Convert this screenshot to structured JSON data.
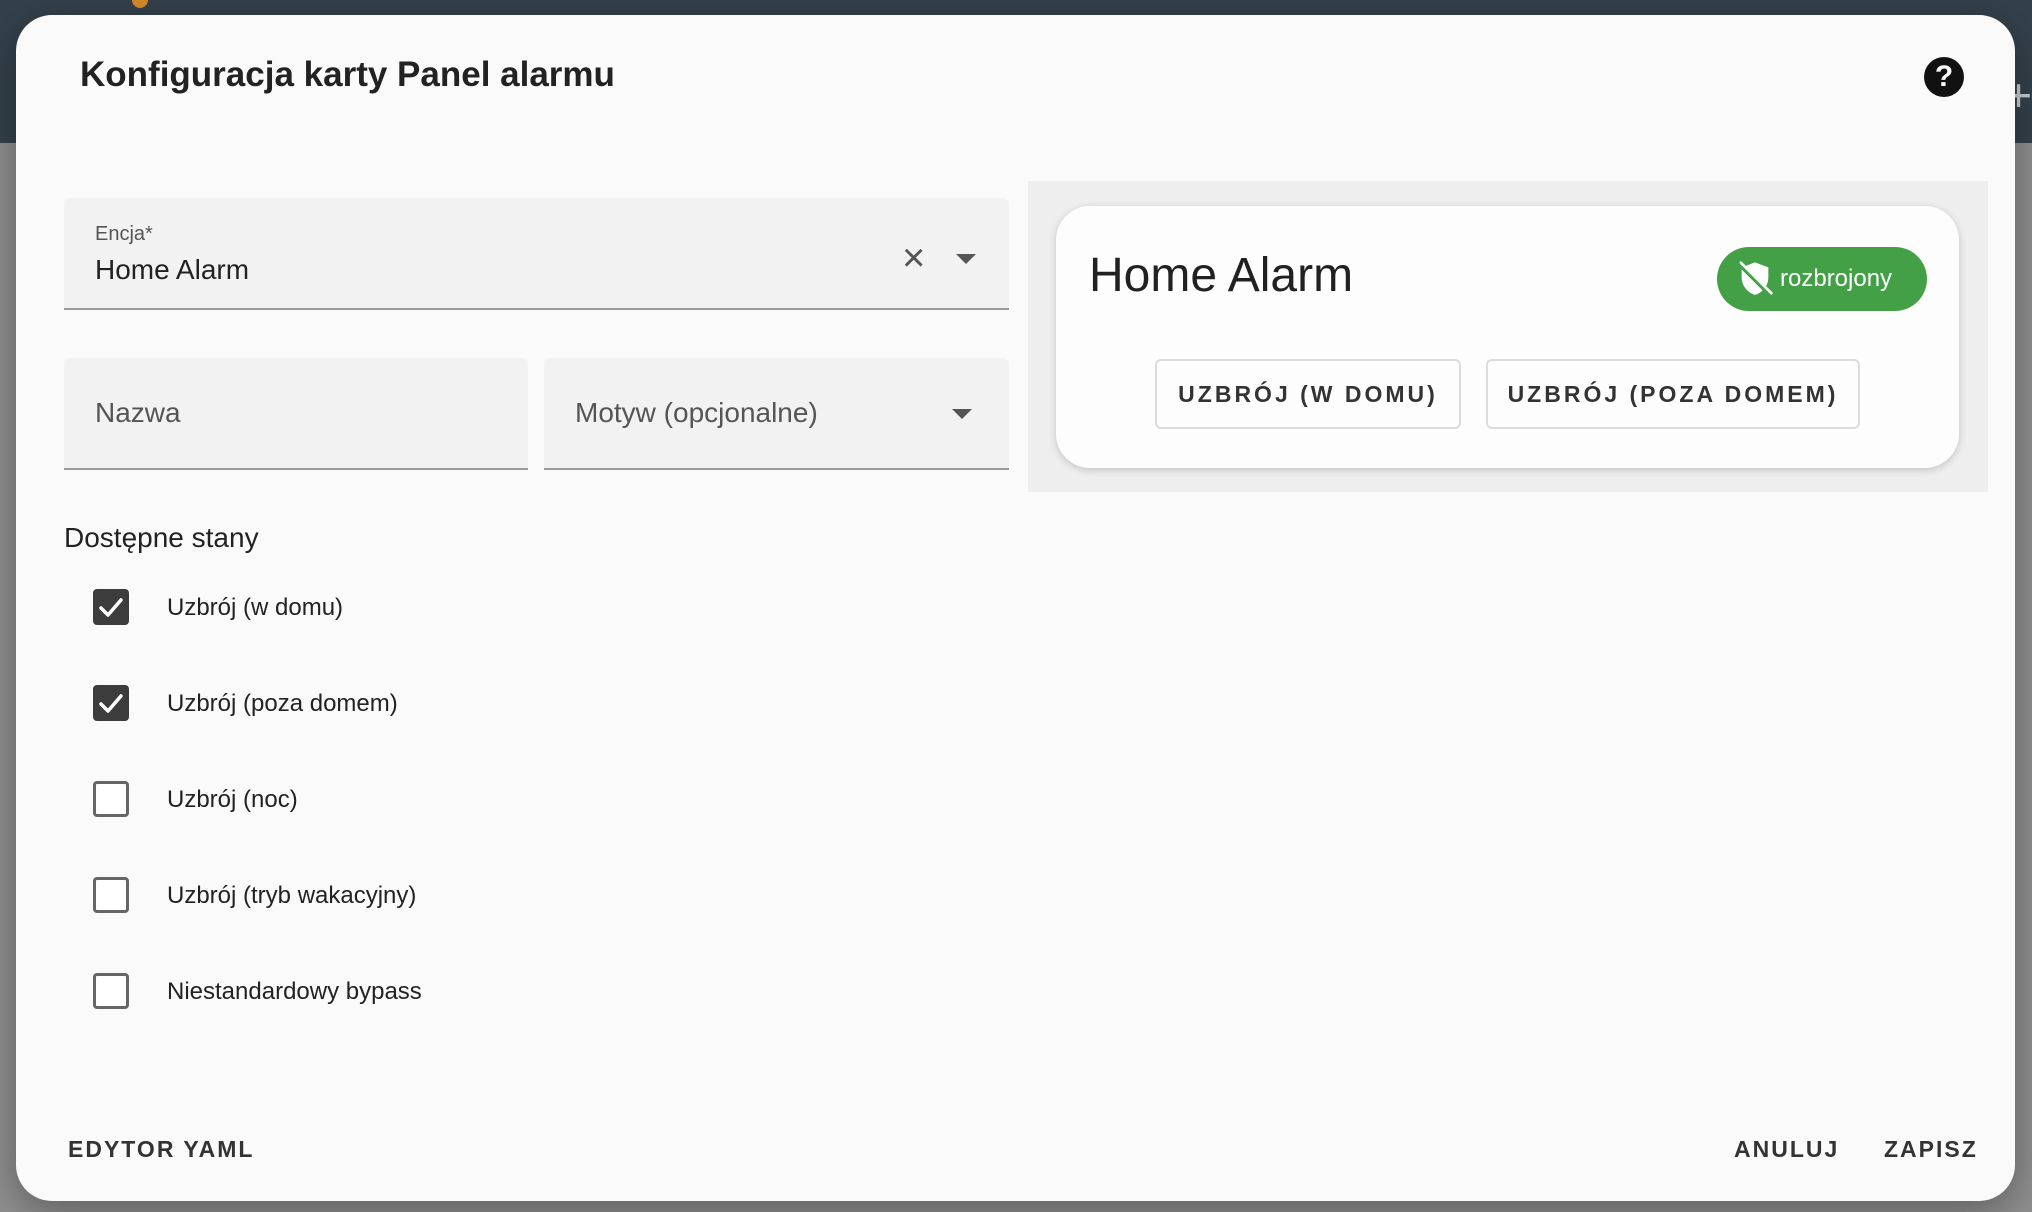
{
  "dialog": {
    "title": "Konfiguracja karty Panel alarmu",
    "help_icon": "?"
  },
  "entity_field": {
    "label": "Encja*",
    "value": "Home Alarm",
    "clear_icon": "×"
  },
  "name_field": {
    "placeholder": "Nazwa"
  },
  "theme_field": {
    "placeholder": "Motyw (opcjonalne)"
  },
  "states": {
    "title": "Dostępne stany",
    "items": [
      {
        "label": "Uzbrój (w domu)",
        "checked": true
      },
      {
        "label": "Uzbrój (poza domem)",
        "checked": true
      },
      {
        "label": "Uzbrój (noc)",
        "checked": false
      },
      {
        "label": "Uzbrój (tryb wakacyjny)",
        "checked": false
      },
      {
        "label": "Niestandardowy bypass",
        "checked": false
      }
    ]
  },
  "preview": {
    "title": "Home Alarm",
    "badge": {
      "text": "rozbrojony",
      "icon": "shield-off-icon",
      "color": "#43a047"
    },
    "buttons": [
      "UZBRÓJ (W DOMU)",
      "UZBRÓJ (POZA DOMEM)"
    ]
  },
  "footer": {
    "yaml_editor": "EDYTOR YAML",
    "cancel": "ANULUJ",
    "save": "ZAPISZ"
  }
}
